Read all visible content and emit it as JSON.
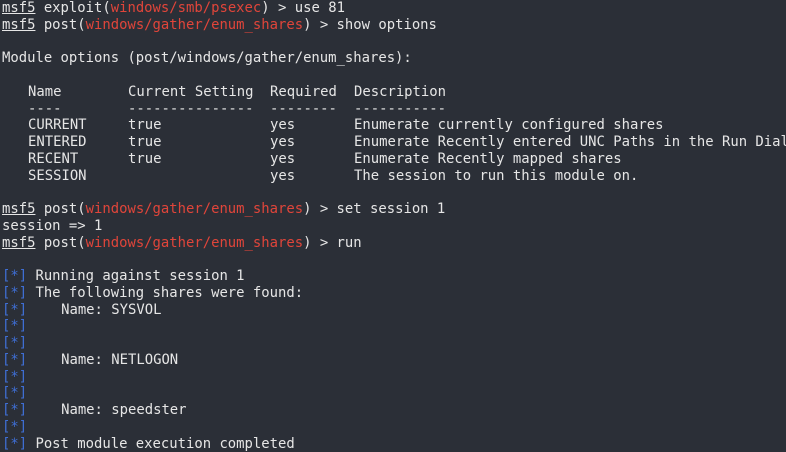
{
  "colors": {
    "background": "#2b2f37",
    "text": "#e6e6e6",
    "module_path": "#e0453a",
    "status_marker": "#3f6fd6"
  },
  "prompt": {
    "msf": "msf5",
    "exploit_prefix": " exploit(",
    "post_prefix": " post(",
    "suffix_close": ")",
    "arrow": " > "
  },
  "lines": {
    "l1_module": "windows/smb/psexec",
    "l1_cmd": "use 81",
    "l2_module": "windows/gather/enum_shares",
    "l2_cmd": "show options",
    "module_options_header": "Module options (post/windows/gather/enum_shares):",
    "set_cmd": "set session 1",
    "set_result": "session => 1",
    "run_cmd": "run"
  },
  "options_table": {
    "headers": [
      "Name",
      "Current Setting",
      "Required",
      "Description"
    ],
    "underlines": [
      "----",
      "---------------",
      "--------",
      "-----------"
    ],
    "rows": [
      [
        "CURRENT",
        "true",
        "yes",
        "Enumerate currently configured shares"
      ],
      [
        "ENTERED",
        "true",
        "yes",
        "Enumerate Recently entered UNC Paths in the Run Dialog"
      ],
      [
        "RECENT",
        "true",
        "yes",
        "Enumerate Recently mapped shares"
      ],
      [
        "SESSION",
        "",
        "yes",
        "The session to run this module on."
      ]
    ]
  },
  "output": {
    "marker": "[*]",
    "running": " Running against session 1",
    "found": " The following shares were found:",
    "shares": [
      "Name: SYSVOL",
      "Name: NETLOGON",
      "Name: speedster"
    ],
    "completed": " Post module execution completed"
  }
}
